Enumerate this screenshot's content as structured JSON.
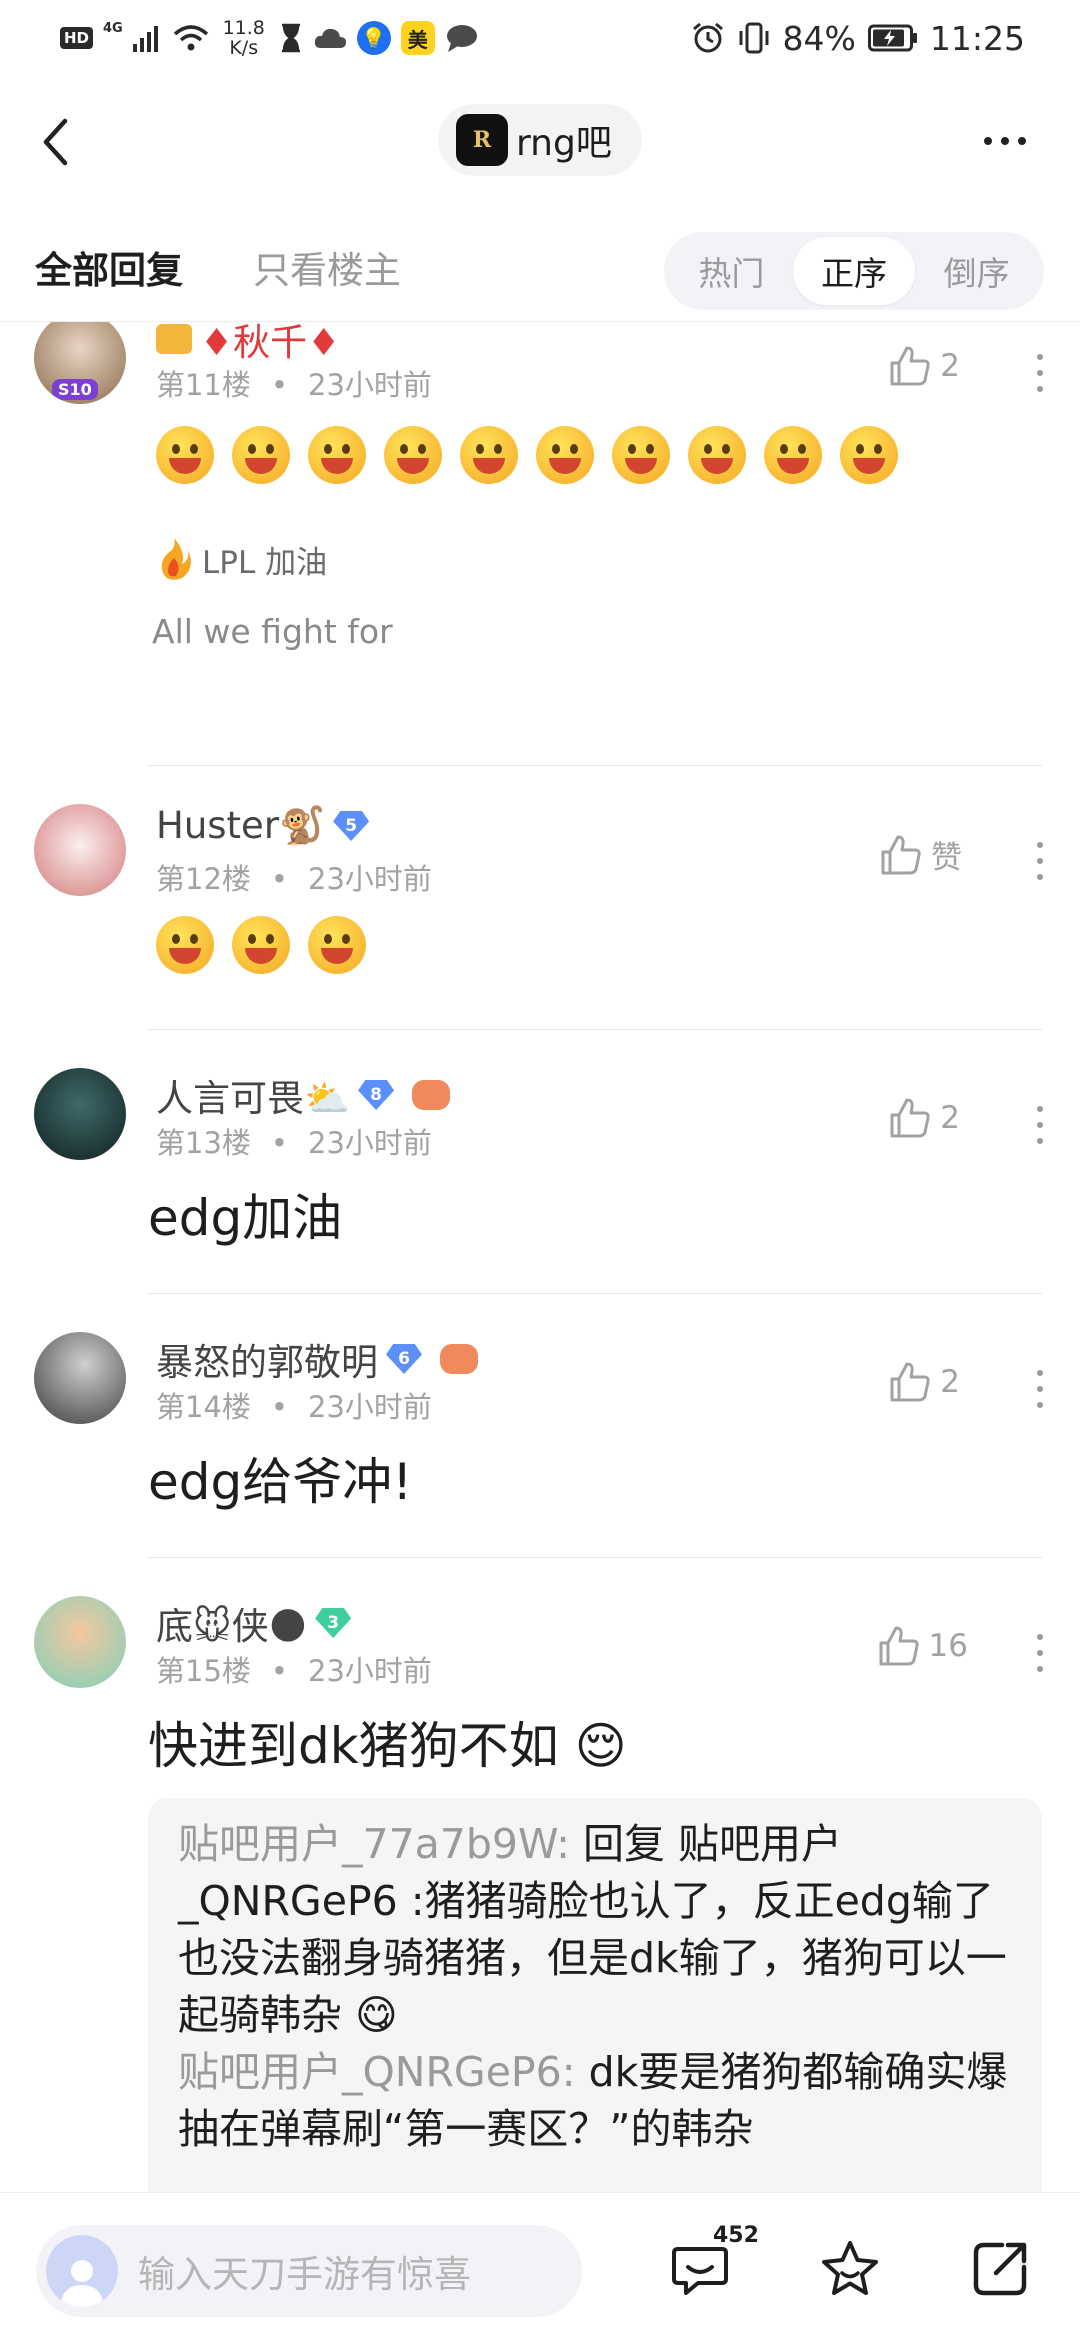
{
  "status_bar": {
    "hd": "HD",
    "network": "4G",
    "speed_value": "11.8",
    "speed_unit": "K/s",
    "badge_mei": "美",
    "battery": "84%",
    "time": "11:25"
  },
  "header": {
    "forum_logo_text": "R",
    "forum_name": "rng吧"
  },
  "tabs": {
    "all": "全部回复",
    "op_only": "只看楼主",
    "sort": [
      "热门",
      "正序",
      "倒序"
    ],
    "active_sort": "正序"
  },
  "posts": [
    {
      "name": "♦秋千♦",
      "floor": "第11楼",
      "time": "23小时前",
      "likes": "2",
      "emoji_count": 10,
      "avatar_badge": "S10",
      "tail_tag": "LPL 加油",
      "tail_text": "All we fight for"
    },
    {
      "name": "Huster🐒",
      "level": "5",
      "floor": "第12楼",
      "time": "23小时前",
      "likes": "赞",
      "emoji_count": 3
    },
    {
      "name": "人言可畏⛅",
      "level": "8",
      "floor": "第13楼",
      "time": "23小时前",
      "likes": "2",
      "content": "edg加油"
    },
    {
      "name": "暴怒的郭敬明",
      "level": "6",
      "floor": "第14楼",
      "time": "23小时前",
      "likes": "2",
      "content": "edg给爷冲!"
    },
    {
      "name": "底🐭侠🌑",
      "level": "3",
      "floor": "第15楼",
      "time": "23小时前",
      "likes": "16",
      "content": "快进到dk猪狗不如 😌",
      "replies": [
        {
          "user": "贴吧用户_77a7b9W:",
          "text": " 回复 贴吧用户_QNRGeP6 :猪猪骑脸也认了，反正edg输了也没法翻身骑猪猪，但是dk输了，猪狗可以一起骑韩杂 😋"
        },
        {
          "user": "贴吧用户_QNRGeP6:",
          "text": " dk要是猪狗都输确实爆抽在弹幕刷“第一赛区？”的韩杂"
        }
      ]
    }
  ],
  "bottom_bar": {
    "input_placeholder": "输入天刀手游有惊喜",
    "comment_count": "452"
  },
  "colors": {
    "accent_gray": "#9a9a9a",
    "level_blue": "#5b8ff9",
    "level_green": "#3ecf9c",
    "quote_bg": "#f5f5f8"
  }
}
